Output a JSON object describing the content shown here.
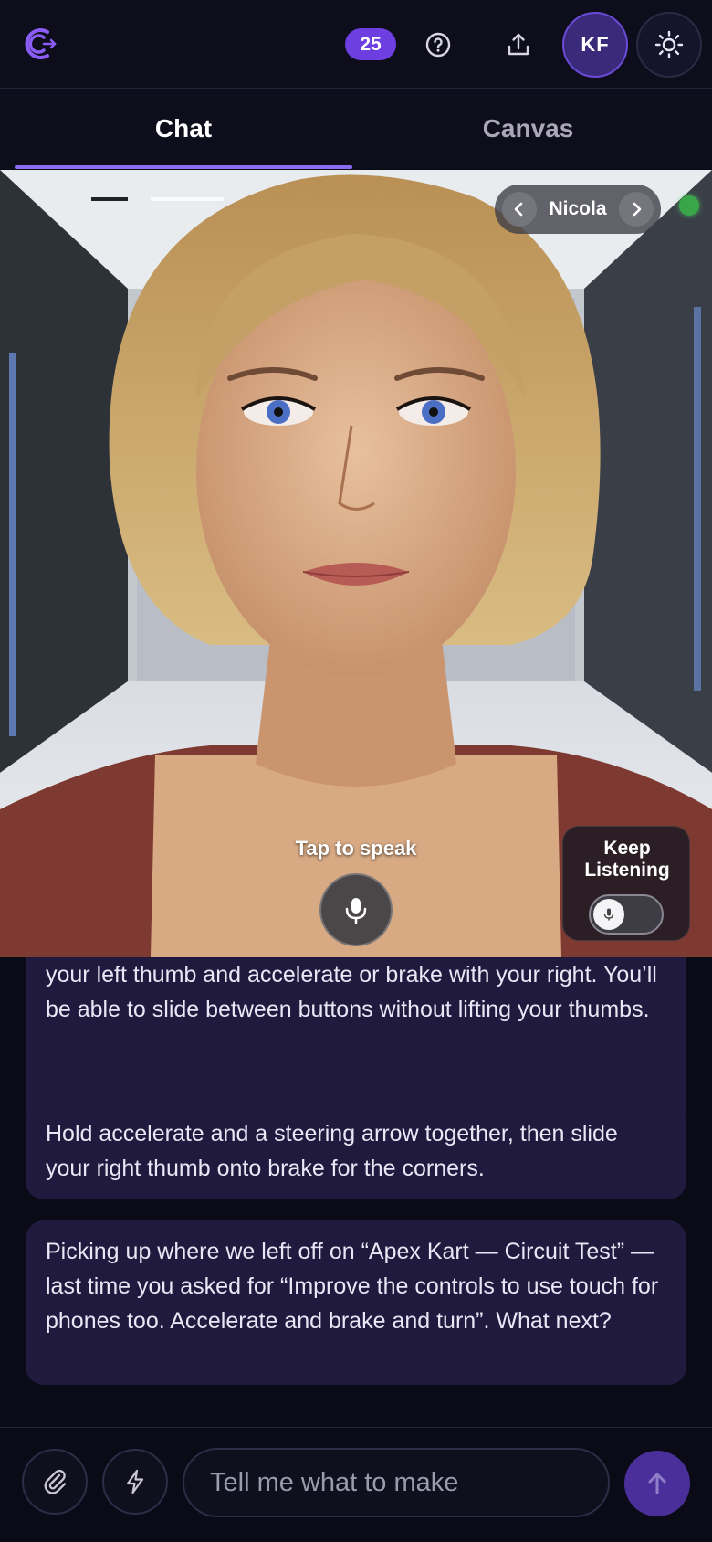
{
  "header": {
    "credits": "25",
    "avatar_initials": "KF",
    "icons": [
      "logo-icon",
      "help-icon",
      "share-icon",
      "sun-icon"
    ]
  },
  "tabs": [
    {
      "label": "Chat",
      "active": true
    },
    {
      "label": "Canvas",
      "active": false
    }
  ],
  "avatar_view": {
    "name": "Nicola",
    "status": "online",
    "tap_label": "Tap to speak",
    "keep_listening_line1": "Keep",
    "keep_listening_line2": "Listening",
    "keep_listening_on": false
  },
  "messages": [
    {
      "text": "your left thumb and accelerate or brake with your right. You’ll be able to slide between buttons without lifting your thumbs."
    },
    {
      "text": "Hold accelerate and a steering arrow together, then slide your right thumb onto brake for the corners."
    },
    {
      "text": "Picking up where we left off on “Apex Kart — Circuit Test” — last time you asked for “Improve the controls to use touch for phones too. Accelerate and brake and turn”. What next?"
    }
  ],
  "composer": {
    "placeholder": "Tell me what to make",
    "value": ""
  },
  "colors": {
    "accent": "#6d3fe0",
    "bubble": "#1f1a3e",
    "background": "#0b0b18",
    "online": "#3aa64a"
  }
}
